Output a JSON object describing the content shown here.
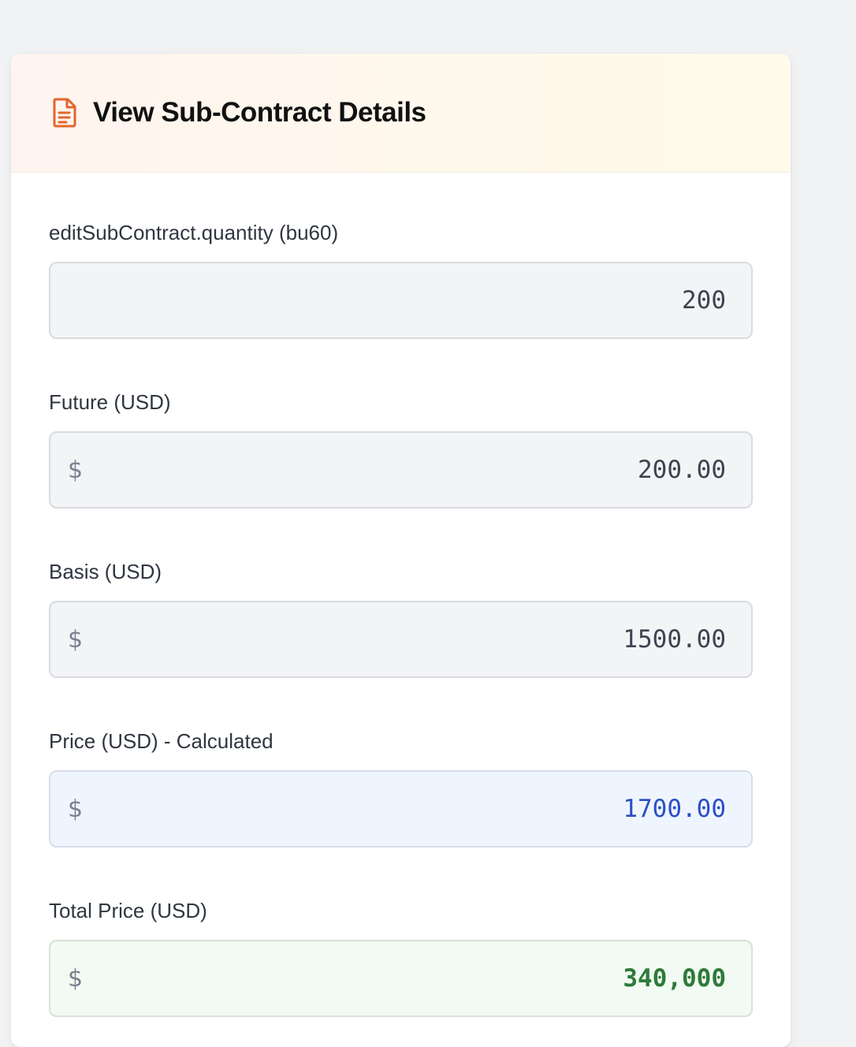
{
  "header": {
    "title": "View Sub-Contract Details",
    "icon": "document-icon",
    "icon_color": "#e2662c"
  },
  "fields": {
    "quantity": {
      "label": "editSubContract.quantity (bu60)",
      "value": "200"
    },
    "future": {
      "label": "Future (USD)",
      "currency": "$",
      "value": "200.00"
    },
    "basis": {
      "label": "Basis (USD)",
      "currency": "$",
      "value": "1500.00"
    },
    "price": {
      "label": "Price (USD) - Calculated",
      "currency": "$",
      "value": "1700.00",
      "accent": "#2b4fc4"
    },
    "total": {
      "label": "Total Price (USD)",
      "currency": "$",
      "value": "340,000",
      "accent": "#2f7a3a"
    }
  }
}
